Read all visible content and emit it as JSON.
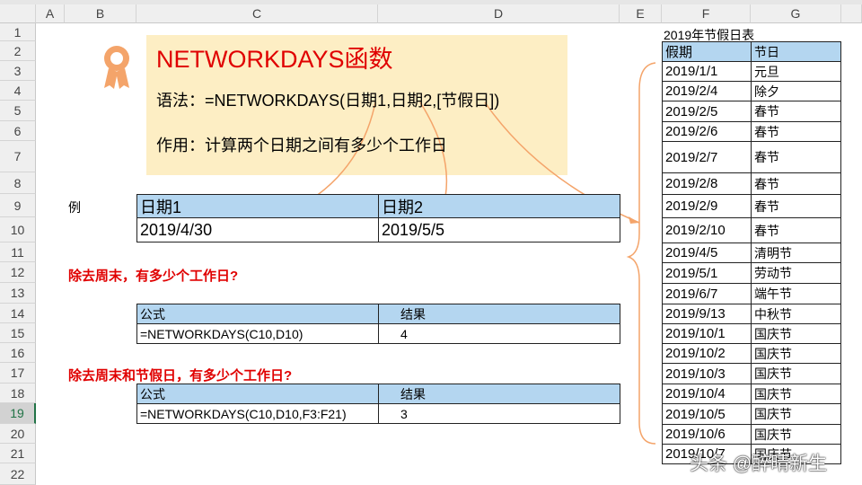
{
  "columns": [
    "A",
    "B",
    "C",
    "D",
    "E",
    "F",
    "G"
  ],
  "rows": [
    "1",
    "2",
    "3",
    "4",
    "5",
    "6",
    "7",
    "8",
    "9",
    "10",
    "11",
    "12",
    "13",
    "14",
    "15",
    "16",
    "17",
    "18",
    "19",
    "20",
    "21",
    "22"
  ],
  "selected_row": "19",
  "title": "NETWORKDAYS函数",
  "syntax": "语法：=NETWORKDAYS(日期1,日期2,[节假日])",
  "purpose": "作用：计算两个日期之间有多少个工作日",
  "example_label": "例",
  "example": {
    "h1": "日期1",
    "h2": "日期2",
    "v1": "2019/4/30",
    "v2": "2019/5/5"
  },
  "q1": "除去周末，有多少个工作日?",
  "q1_table": {
    "h1": "公式",
    "h2": "结果",
    "formula": "=NETWORKDAYS(C10,D10)",
    "result": "4"
  },
  "q2": "除去周末和节假日，有多少个工作日?",
  "q2_table": {
    "h1": "公式",
    "h2": "结果",
    "formula": "=NETWORKDAYS(C10,D10,F3:F21)",
    "result": "3"
  },
  "holiday_title": "2019年节假日表",
  "holiday_headers": [
    "假期",
    "节日"
  ],
  "holidays": [
    [
      "2019/1/1",
      "元旦"
    ],
    [
      "2019/2/4",
      "除夕"
    ],
    [
      "2019/2/5",
      "春节"
    ],
    [
      "2019/2/6",
      "春节"
    ],
    [
      "2019/2/7",
      "春节"
    ],
    [
      "2019/2/8",
      "春节"
    ],
    [
      "2019/2/9",
      "春节"
    ],
    [
      "2019/2/10",
      "春节"
    ],
    [
      "2019/4/5",
      "清明节"
    ],
    [
      "2019/5/1",
      "劳动节"
    ],
    [
      "2019/6/7",
      "端午节"
    ],
    [
      "2019/9/13",
      "中秋节"
    ],
    [
      "2019/10/1",
      "国庆节"
    ],
    [
      "2019/10/2",
      "国庆节"
    ],
    [
      "2019/10/3",
      "国庆节"
    ],
    [
      "2019/10/4",
      "国庆节"
    ],
    [
      "2019/10/5",
      "国庆节"
    ],
    [
      "2019/10/6",
      "国庆节"
    ],
    [
      "2019/10/7",
      "国庆节"
    ]
  ],
  "watermark": "头条 @醉晴新生",
  "colors": {
    "accent": "#f4a46a",
    "title_red": "#e00000",
    "header_blue": "#b4d6f0",
    "note_yellow": "#fdeec4"
  }
}
